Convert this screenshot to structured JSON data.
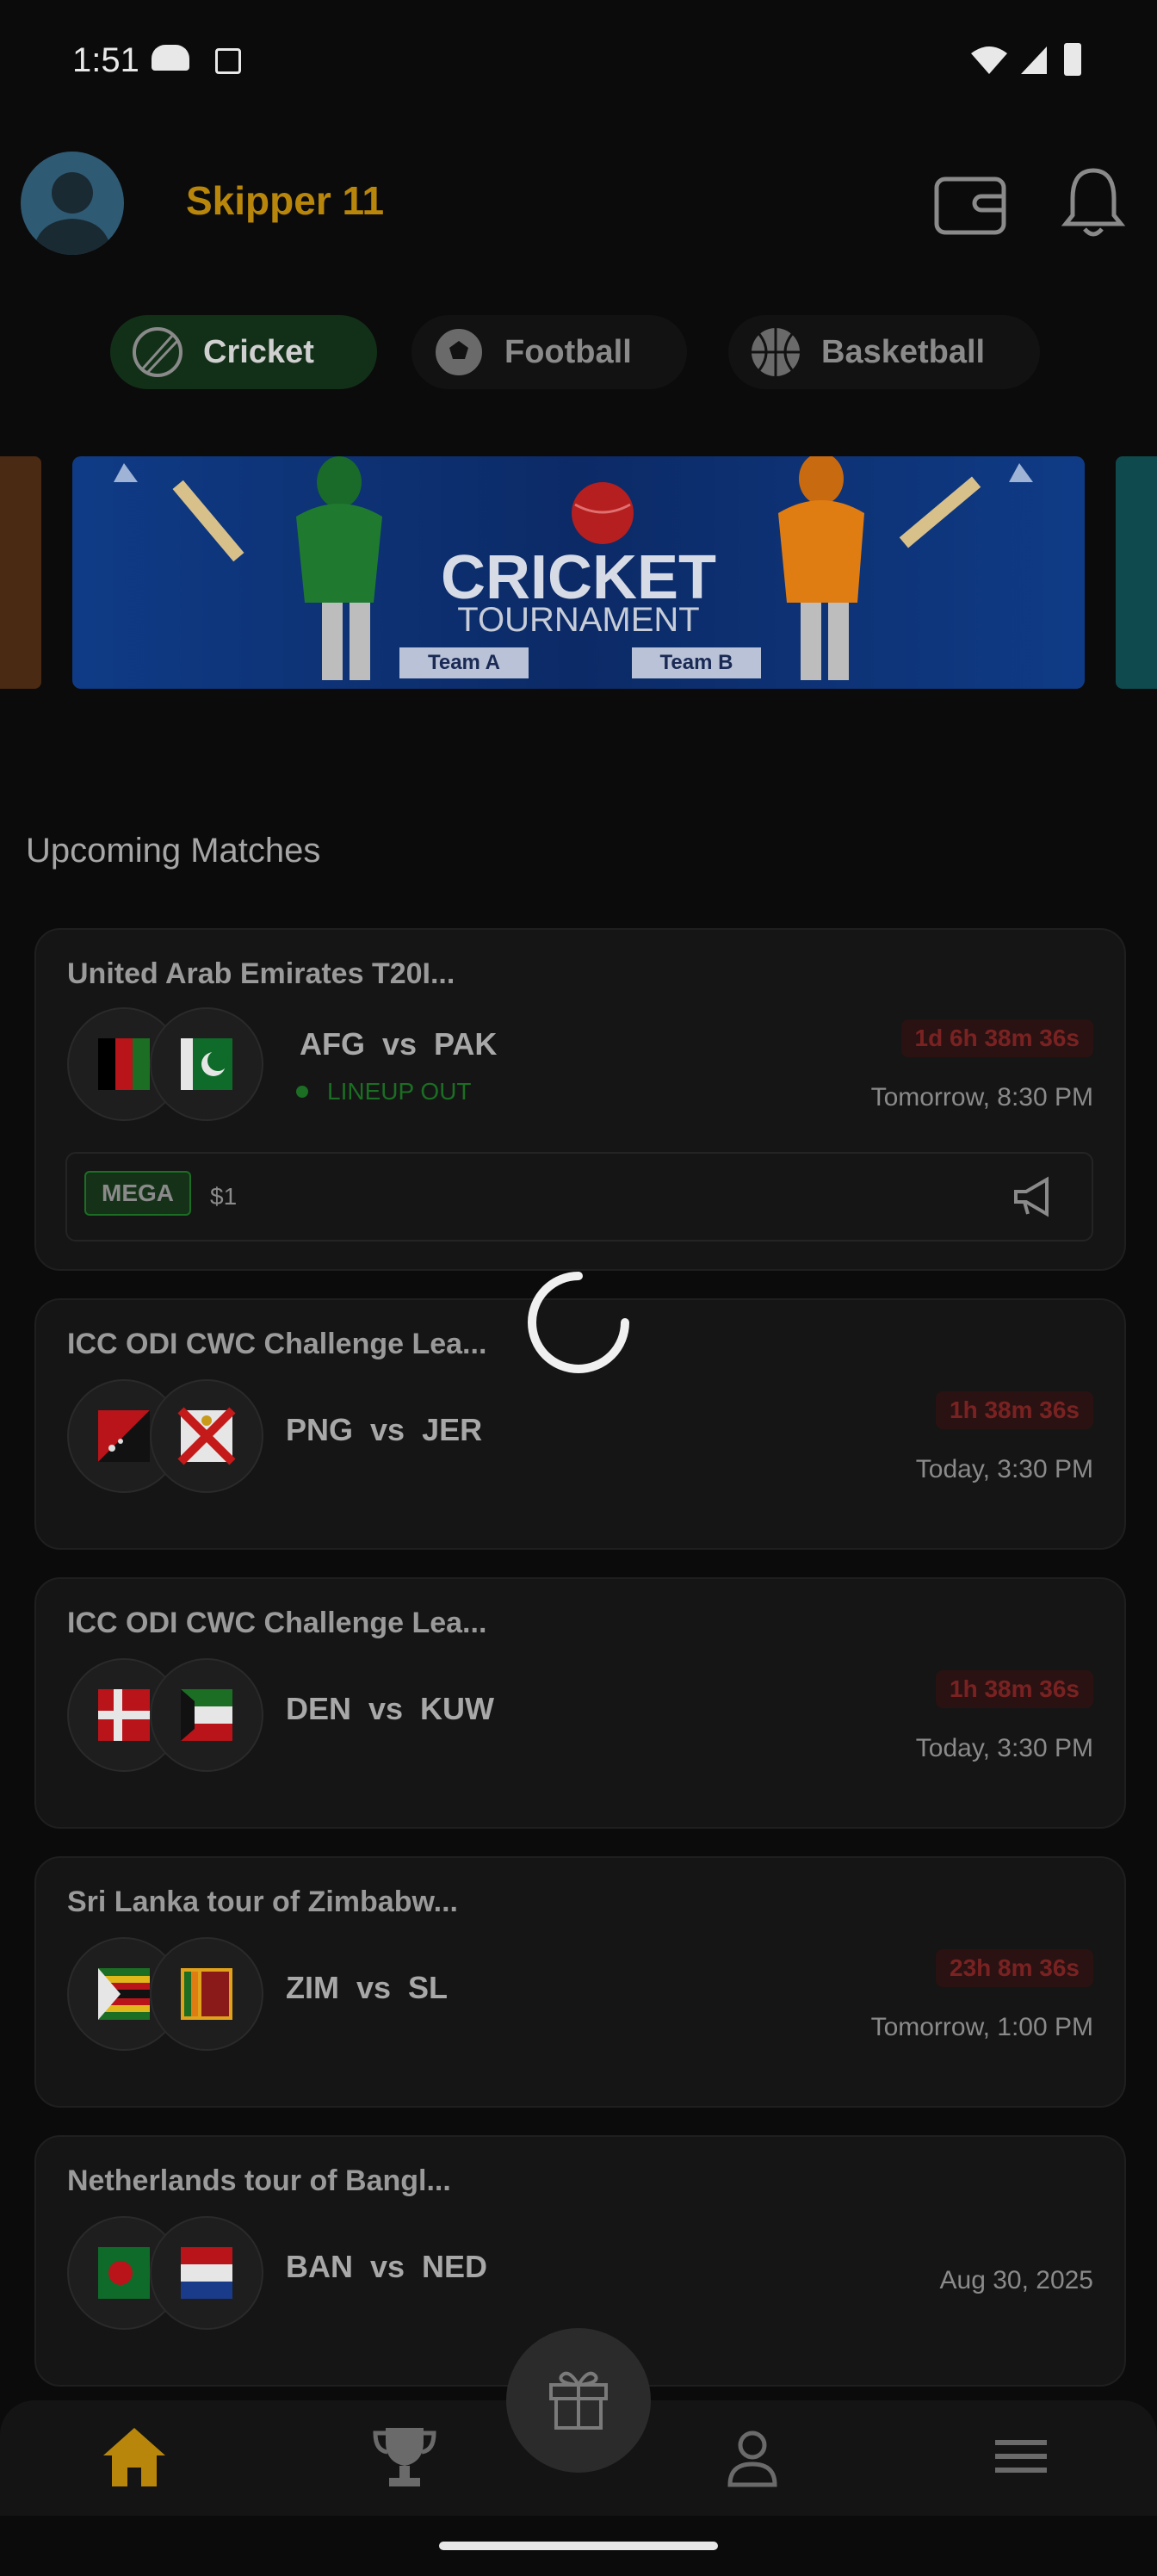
{
  "status_bar": {
    "time": "1:51"
  },
  "header": {
    "title": "Skipper 11"
  },
  "sport_tabs": [
    {
      "label": "Cricket",
      "icon": "cricket-ball-icon",
      "selected": true
    },
    {
      "label": "Football",
      "icon": "football-icon",
      "selected": false
    },
    {
      "label": "Basketball",
      "icon": "basketball-icon",
      "selected": false
    }
  ],
  "banner": {
    "title": "CRICKET",
    "subtitle": "TOURNAMENT",
    "team_a": "Team A",
    "team_b": "Team B"
  },
  "section_title": "Upcoming Matches",
  "matches": [
    {
      "series": "United Arab Emirates T20I...",
      "teams": "AFG  vs  PAK",
      "timer": "1d 6h 38m 36s",
      "when": "Tomorrow, 8:30 PM",
      "lineup": "LINEUP OUT",
      "contest_tag": "MEGA",
      "contest_amount": "$1"
    },
    {
      "series": "ICC ODI CWC Challenge Lea...",
      "teams": "PNG  vs  JER",
      "timer": "1h 38m 36s",
      "when": "Today, 3:30 PM"
    },
    {
      "series": "ICC ODI CWC Challenge Lea...",
      "teams": "DEN  vs  KUW",
      "timer": "1h 38m 36s",
      "when": "Today, 3:30 PM"
    },
    {
      "series": "Sri Lanka tour of Zimbabw...",
      "teams": "ZIM  vs  SL",
      "timer": "23h 8m 36s",
      "when": "Tomorrow, 1:00 PM"
    },
    {
      "series": "Netherlands tour of Bangl...",
      "teams": "BAN  vs  NED",
      "when": "Aug 30, 2025"
    }
  ],
  "bottom_nav": [
    {
      "icon": "home-icon",
      "active": true
    },
    {
      "icon": "trophy-icon",
      "active": false
    },
    {
      "icon": "gift-icon",
      "active": false
    },
    {
      "icon": "profile-icon",
      "active": false
    },
    {
      "icon": "menu-icon",
      "active": false
    }
  ],
  "colors": {
    "brand": "#b8860b",
    "live_green": "#1b6e23",
    "timer_red": "#7a2222"
  }
}
